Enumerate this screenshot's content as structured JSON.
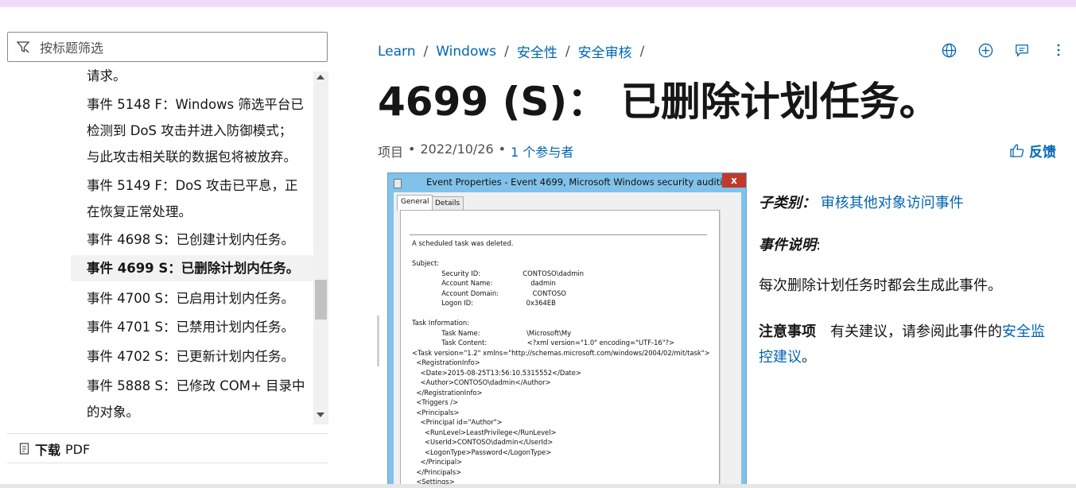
{
  "filter": {
    "placeholder": "按标题筛选"
  },
  "toc": {
    "items": [
      {
        "label": "请求。",
        "selected": false
      },
      {
        "label": "事件 5148 F：Windows 筛选平台已\n检测到 DoS 攻击并进入防御模式；\n与此攻击相关联的数据包将被放弃。",
        "selected": false
      },
      {
        "label": "事件 5149 F：DoS 攻击已平息，正\n在恢复正常处理。",
        "selected": false
      },
      {
        "label": "事件 4698 S：已创建计划内任务。",
        "selected": false
      },
      {
        "label": "事件 4699 S：已删除计划内任务。",
        "selected": true
      },
      {
        "label": "事件 4700 S：已启用计划内任务。",
        "selected": false
      },
      {
        "label": "事件 4701 S：已禁用计划内任务。",
        "selected": false
      },
      {
        "label": "事件 4702 S：已更新计划内任务。",
        "selected": false
      },
      {
        "label": "事件 5888 S：已修改 COM+ 目录中\n的对象。",
        "selected": false
      }
    ]
  },
  "pdf": {
    "bold": "下载",
    "rest": "PDF"
  },
  "breadcrumb": {
    "items": [
      "Learn",
      "Windows",
      "安全性",
      "安全审核"
    ],
    "sep": "/"
  },
  "title": "4699 (S)： 已删除计划任务。",
  "meta": {
    "type": "项目",
    "dot": "•",
    "date": "2022/10/26",
    "contributors": "1 个参与者"
  },
  "feedback": "反馈",
  "dialog": {
    "title": "Event Properties - Event 4699, Microsoft Windows security auditing.",
    "close": "x",
    "tabs": [
      "General",
      "Details"
    ],
    "content": "A scheduled task was deleted.\n\nSubject:\n              Security ID:                    CONTOSO\\dadmin\n              Account Name:                  dadmin\n              Account Domain:                CONTOSO\n              Logon ID:                         0x364EB\n\nTask Information:\n              Task Name:                      \\Microsoft\\My\n              Task Content:                   <?xml version=\"1.0\" encoding=\"UTF-16\"?>\n<Task version=\"1.2\" xmlns=\"http://schemas.microsoft.com/windows/2004/02/mit/task\">\n  <RegistrationInfo>\n    <Date>2015-08-25T13:56:10.5315552</Date>\n    <Author>CONTOSO\\dadmin</Author>\n  </RegistrationInfo>\n  <Triggers />\n  <Principals>\n    <Principal id=\"Author\">\n      <RunLevel>LeastPrivilege</RunLevel>\n      <UserId>CONTOSO\\dadmin</UserId>\n      <LogonType>Password</LogonType>\n    </Principal>\n  </Principals>\n  <Settings>\n    <MultipleInstancesPolicy>IgnoreNew</MultipleInstancesPolicy>\n    <DisallowStartIfOnBatteries>false</DisallowStartIfOnBatteries>"
  },
  "subcategory": {
    "key": "子类别：",
    "value": "审核其他对象访问事件"
  },
  "event_desc": {
    "key": "事件说明",
    "colon": ":"
  },
  "event_text": "每次删除计划任务时都会生成此事件。",
  "note": {
    "key": "注意事项",
    "text": "有关建议，请参阅此事件的",
    "link": "安全监控建议",
    "end": "。"
  },
  "colors": {
    "link": "#0065b3",
    "topbar": "#f0dcf8",
    "selected_bg": "#f2f2f2"
  },
  "icons": [
    "filter-icon",
    "globe-icon",
    "plus-circle-icon",
    "comment-icon",
    "more-icon",
    "thumbs-up-icon",
    "pdf-icon"
  ]
}
